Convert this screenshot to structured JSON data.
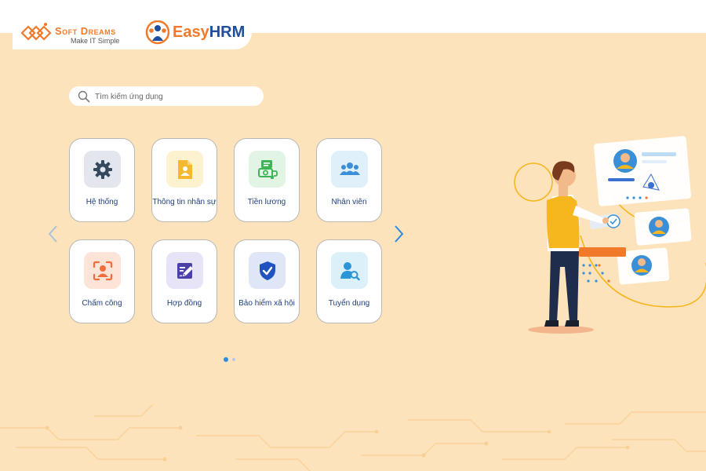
{
  "brand": {
    "softdreams_name": "Soft Dreams",
    "softdreams_tagline": "Make IT Simple",
    "easyhrm_part1": "Easy",
    "easyhrm_part2": "HRM"
  },
  "search": {
    "placeholder": "Tìm kiếm ứng dụng",
    "value": ""
  },
  "apps": [
    {
      "label": "Hệ thống",
      "icon": "gear-icon",
      "bg": "#e3e6ec",
      "color": "#34495e"
    },
    {
      "label": "Thông tin nhân sự",
      "icon": "profile-document-icon",
      "bg": "#fdf2d0",
      "color": "#f5b82e"
    },
    {
      "label": "Tiền lương",
      "icon": "payroll-icon",
      "bg": "#e2f5e4",
      "color": "#3eb457"
    },
    {
      "label": "Nhân viên",
      "icon": "employees-icon",
      "bg": "#dff0fb",
      "color": "#3b8fd6"
    },
    {
      "label": "Chấm công",
      "icon": "face-scan-icon",
      "bg": "#fde4d9",
      "color": "#f26d3d"
    },
    {
      "label": "Hợp đồng",
      "icon": "contract-edit-icon",
      "bg": "#e6e4f6",
      "color": "#4b3fa8"
    },
    {
      "label": "Bảo hiểm xã hội",
      "icon": "shield-check-icon",
      "bg": "#dfe6f7",
      "color": "#2152c0"
    },
    {
      "label": "Tuyển dụng",
      "icon": "recruit-search-icon",
      "bg": "#dcf0fa",
      "color": "#2b95d6"
    }
  ],
  "carousel": {
    "pages": 2,
    "active_page": 1
  },
  "colors": {
    "background": "#fde3bb",
    "tile_label": "#1e3f7a",
    "arrow": "#2f8be0",
    "accent_orange": "#f07a2a",
    "accent_blue": "#1f4e9c"
  }
}
